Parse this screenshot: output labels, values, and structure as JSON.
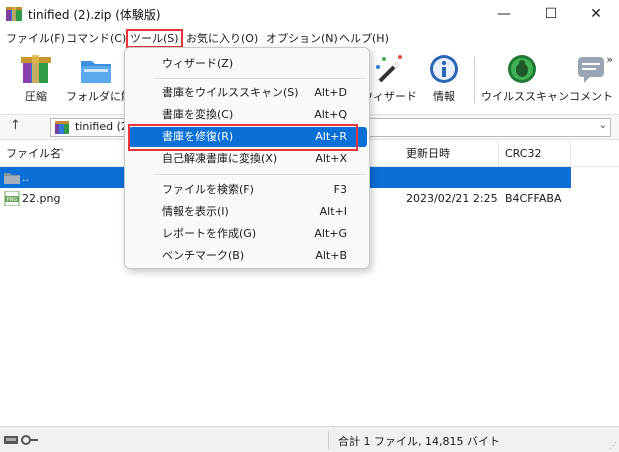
{
  "window": {
    "title": "tinified (2).zip (体験版)",
    "minimize_glyph": "—",
    "maximize_glyph": "☐",
    "close_glyph": "✕"
  },
  "menubar": {
    "items": [
      {
        "label": "ファイル(F)"
      },
      {
        "label": "コマンド(C)"
      },
      {
        "label": "ツール(S)",
        "active": true
      },
      {
        "label": "お気に入り(O)"
      },
      {
        "label": "オプション(N)"
      },
      {
        "label": "ヘルプ(H)"
      }
    ]
  },
  "toolbar": {
    "buttons": [
      {
        "label": "圧縮",
        "icon": "compress-icon"
      },
      {
        "label": "フォルダに解",
        "icon": "extract-folder-icon"
      },
      {
        "label": "ウィザード",
        "icon": "wizard-icon"
      },
      {
        "label": "情報",
        "icon": "info-icon"
      },
      {
        "label": "ウイルススキャン",
        "icon": "virus-scan-icon"
      },
      {
        "label": "コメント",
        "icon": "comment-icon"
      }
    ],
    "more_glyph": "»"
  },
  "address": {
    "up_glyph": "↑",
    "path": "tinified (2",
    "dropdown_glyph": "⌄"
  },
  "filelist": {
    "columns": [
      {
        "label": "ファイル名"
      },
      {
        "label": "更新日時"
      },
      {
        "label": "CRC32"
      }
    ],
    "rows": [
      {
        "name": "..",
        "modified": "",
        "crc": "",
        "type": "folder",
        "selected": true
      },
      {
        "name": "22.png",
        "modified": "2023/02/21 2:25",
        "crc": "B4CFFABA",
        "type": "png",
        "selected": false
      }
    ]
  },
  "status": {
    "text": "合計 1 ファイル, 14,815 バイト"
  },
  "tools_menu": {
    "items": [
      {
        "label": "ウィザード(Z)",
        "shortcut": ""
      },
      {
        "label": "書庫をウイルススキャン(S)",
        "shortcut": "Alt+D"
      },
      {
        "label": "書庫を変換(C)",
        "shortcut": "Alt+Q"
      },
      {
        "label": "書庫を修復(R)",
        "shortcut": "Alt+R",
        "highlighted": true
      },
      {
        "label": "自己解凍書庫に変換(X)",
        "shortcut": "Alt+X"
      },
      {
        "label": "ファイルを検索(F)",
        "shortcut": "F3"
      },
      {
        "label": "情報を表示(I)",
        "shortcut": "Alt+I"
      },
      {
        "label": "レポートを作成(G)",
        "shortcut": "Alt+G"
      },
      {
        "label": "ベンチマーク(B)",
        "shortcut": "Alt+B"
      }
    ]
  },
  "colors": {
    "selection": "#0a6fd6",
    "highlight_frame": "#e8323c"
  }
}
